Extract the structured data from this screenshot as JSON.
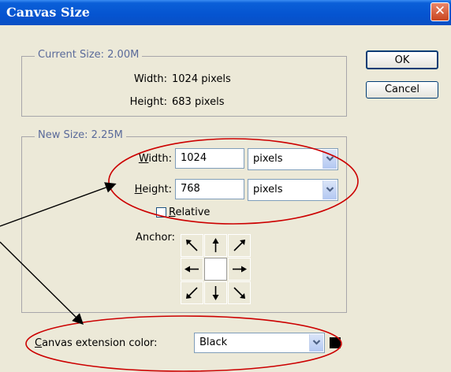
{
  "window": {
    "title": "Canvas Size",
    "close_glyph": "✕"
  },
  "current_size": {
    "label": "Current Size: 2.00M",
    "width_label": "Width:",
    "width_value": "1024 pixels",
    "height_label": "Height:",
    "height_value": "683 pixels"
  },
  "new_size": {
    "label": "New Size: 2.25M",
    "width_label_accel": "W",
    "width_label_rest": "idth:",
    "width_value": "1024",
    "width_unit": "pixels",
    "height_label_accel": "H",
    "height_label_rest": "eight:",
    "height_value": "768",
    "height_unit": "pixels",
    "relative_label_accel": "R",
    "relative_label_rest": "elative",
    "relative_checked": false,
    "anchor_label": "Anchor:",
    "anchor_selected": "center"
  },
  "buttons": {
    "ok": "OK",
    "cancel": "Cancel"
  },
  "extension": {
    "label_accel": "C",
    "label_rest": "anvas extension color:",
    "value": "Black",
    "swatch_color": "#000000"
  },
  "annotation_color": "#cc0000"
}
